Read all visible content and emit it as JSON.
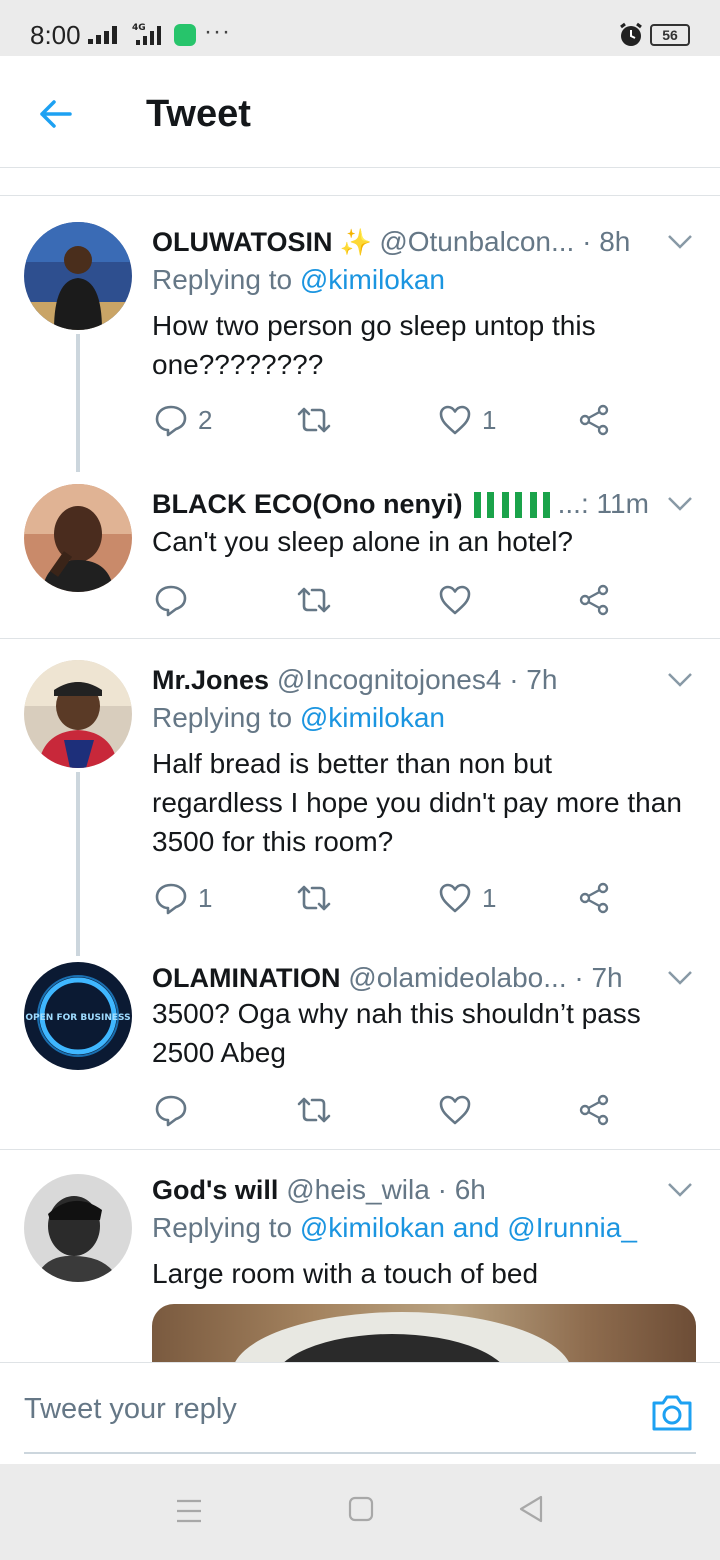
{
  "status_bar": {
    "time": "8:00",
    "network": "4G",
    "more": "···",
    "battery": "56"
  },
  "header": {
    "title": "Tweet"
  },
  "tweets": [
    {
      "name": "OLUWATOSIN",
      "handle": "@Otunbalcon...",
      "time": "· 8h",
      "replying_label": "Replying to",
      "replying_to": "@kimilokan",
      "text": "How two person go sleep untop this one????????",
      "reply_count": "2",
      "like_count": "1"
    },
    {
      "name": "BLACK ECO(Ono nenyi)",
      "handle": "...:",
      "time": "11m",
      "text": "Can't you sleep alone in an hotel?"
    },
    {
      "name": "Mr.Jones",
      "handle": "@Incognitojones4",
      "time": "· 7h",
      "replying_label": "Replying to",
      "replying_to": "@kimilokan",
      "text": "Half bread is better than non but regardless I hope you didn't pay more than 3500 for this room?",
      "reply_count": "1",
      "like_count": "1"
    },
    {
      "name": "OLAMINATION",
      "handle": "@olamideolabo...",
      "time": "· 7h",
      "text": "3500? Oga why nah this shouldn’t pass 2500 Abeg",
      "avatar_text": "OPEN FOR BUSINESS"
    },
    {
      "name": "God's will",
      "handle": "@heis_wila",
      "time": "· 6h",
      "replying_label": "Replying to",
      "replying_to": "@kimilokan and @Irunnia_",
      "text": "Large room with a touch of bed"
    }
  ],
  "reply_bar": {
    "placeholder": "Tweet your reply"
  },
  "colors": {
    "accent": "#1da1f2",
    "link": "#1b95e0",
    "muted": "#657786",
    "divider": "#dfe3e6"
  }
}
